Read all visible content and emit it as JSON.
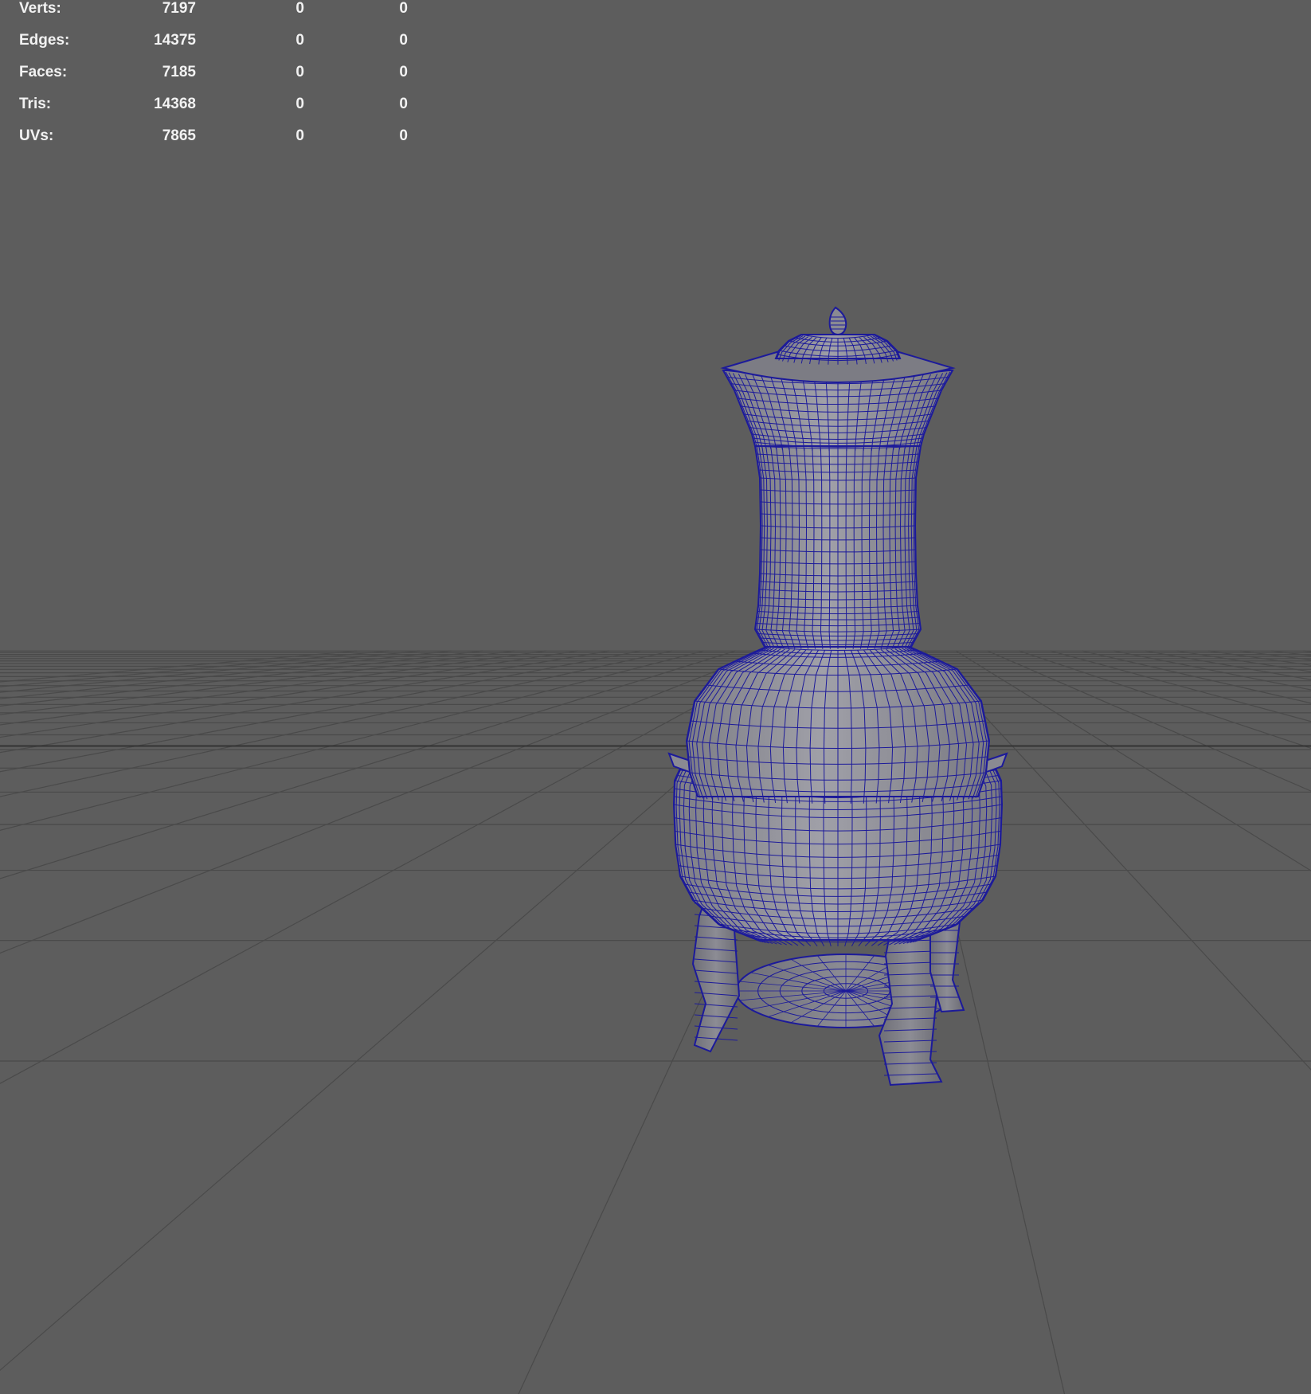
{
  "stats": {
    "rows": [
      {
        "label": "Verts:",
        "total": "7197",
        "selected": "0",
        "extra": "0"
      },
      {
        "label": "Edges:",
        "total": "14375",
        "selected": "0",
        "extra": "0"
      },
      {
        "label": "Faces:",
        "total": "7185",
        "selected": "0",
        "extra": "0"
      },
      {
        "label": "Tris:",
        "total": "14368",
        "selected": "0",
        "extra": "0"
      },
      {
        "label": "UVs:",
        "total": "7865",
        "selected": "0",
        "extra": "0"
      }
    ]
  },
  "colors": {
    "background": "#5d5d5d",
    "grid_line": "#4a4a4a",
    "grid_axis": "#333333",
    "mesh_fill": "#8f8f97",
    "wireframe": "#1c1a9a",
    "hud_text": "#f2f2f2"
  },
  "viewport": {
    "display_mode": "wireframe-on-shaded",
    "object": "samovar-mesh"
  }
}
